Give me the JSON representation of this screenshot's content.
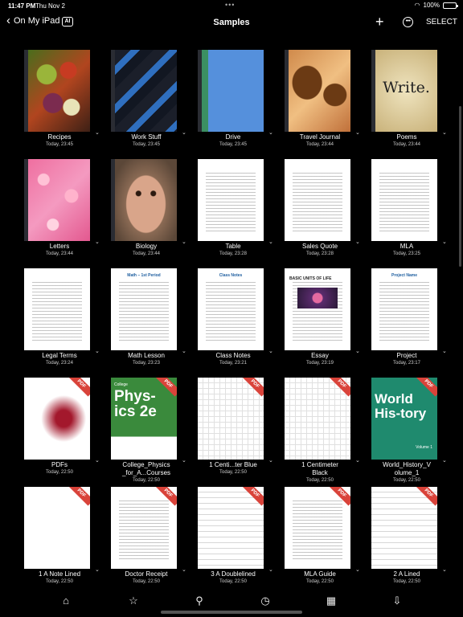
{
  "status": {
    "time": "11:47 PM",
    "date": "Thu Nov 2",
    "dots": "•••",
    "battery": "100%"
  },
  "nav": {
    "back_label": "On My iPad",
    "ai_label": "AI",
    "title": "Samples",
    "plus": "+",
    "more": "•••",
    "select": "SELECT"
  },
  "docs": [
    {
      "name": "Recipes",
      "date": "Today, 23:45",
      "kind": "notebook",
      "cover": "recipes"
    },
    {
      "name": "Work Stuff",
      "date": "Today, 23:45",
      "kind": "notebook",
      "cover": "work"
    },
    {
      "name": "Drive",
      "date": "Today, 23:45",
      "kind": "notebook",
      "cover": "drive"
    },
    {
      "name": "Travel Journal",
      "date": "Today, 23:44",
      "kind": "notebook",
      "cover": "travel"
    },
    {
      "name": "Poems",
      "date": "Today, 23:44",
      "kind": "notebook",
      "cover": "poems",
      "cover_text": "Write."
    },
    {
      "name": "Letters",
      "date": "Today, 23:44",
      "kind": "notebook",
      "cover": "letters"
    },
    {
      "name": "Biology",
      "date": "Today, 23:44",
      "kind": "notebook",
      "cover": "biology"
    },
    {
      "name": "Table",
      "date": "Today, 23:28",
      "kind": "doc",
      "cover": "textdoc"
    },
    {
      "name": "Sales Quote",
      "date": "Today, 23:28",
      "kind": "doc",
      "cover": "textdoc"
    },
    {
      "name": "MLA",
      "date": "Today, 23:25",
      "kind": "doc",
      "cover": "textdoc"
    },
    {
      "name": "Legal Terms",
      "date": "Today, 23:24",
      "kind": "doc",
      "cover": "legal"
    },
    {
      "name": "Math Lesson",
      "date": "Today, 23:23",
      "kind": "doc",
      "cover": "math",
      "cover_text": "Math – 1st Period"
    },
    {
      "name": "Class Notes",
      "date": "Today, 23:21",
      "kind": "doc",
      "cover": "classnotes",
      "cover_text": "Class Notes"
    },
    {
      "name": "Essay",
      "date": "Today, 23:19",
      "kind": "doc",
      "cover": "essay",
      "cover_text": "BASIC UNITS OF LIFE"
    },
    {
      "name": "Project",
      "date": "Today, 23:17",
      "kind": "doc",
      "cover": "project",
      "cover_text": "Project Name"
    },
    {
      "name": "PDFs",
      "date": "Today, 22:50",
      "kind": "pdf",
      "cover": "pdfs"
    },
    {
      "name": "College_Physics\n_for_A...Courses",
      "date": "Today, 22:50",
      "kind": "pdf",
      "cover": "physics",
      "cover_text": "Phys-ics 2e",
      "cover_small": "College"
    },
    {
      "name": "1 Centi...ter Blue",
      "date": "Today, 22:50",
      "kind": "pdf",
      "cover": "gridblue"
    },
    {
      "name": "1 Centimeter\nBlack",
      "date": "Today, 22:50",
      "kind": "pdf",
      "cover": "gridblack"
    },
    {
      "name": "World_History_V\nolume_1",
      "date": "Today, 22:50",
      "kind": "pdf",
      "cover": "world",
      "cover_text": "World His-tory",
      "cover_small": "Volume 1"
    },
    {
      "name": "1 A Note Lined",
      "date": "Today, 22:50",
      "kind": "pdf",
      "cover": "blank"
    },
    {
      "name": "Doctor Receipt",
      "date": "Today, 22:50",
      "kind": "pdf",
      "cover": "form"
    },
    {
      "name": "3 A Doublelined",
      "date": "Today, 22:50",
      "kind": "pdf",
      "cover": "lined"
    },
    {
      "name": "MLA Guide",
      "date": "Today, 22:50",
      "kind": "pdf",
      "cover": "mlaguide"
    },
    {
      "name": "2 A Lined",
      "date": "Today, 22:50",
      "kind": "pdf",
      "cover": "lined"
    }
  ],
  "pdf_badge": "PDF",
  "tabs": [
    {
      "name": "home-icon",
      "glyph": "⌂"
    },
    {
      "name": "star-icon",
      "glyph": "☆"
    },
    {
      "name": "search-icon",
      "glyph": "⚲"
    },
    {
      "name": "clock-icon",
      "glyph": "◷"
    },
    {
      "name": "grid-icon",
      "glyph": "▦"
    },
    {
      "name": "download-icon",
      "glyph": "⇩"
    }
  ]
}
